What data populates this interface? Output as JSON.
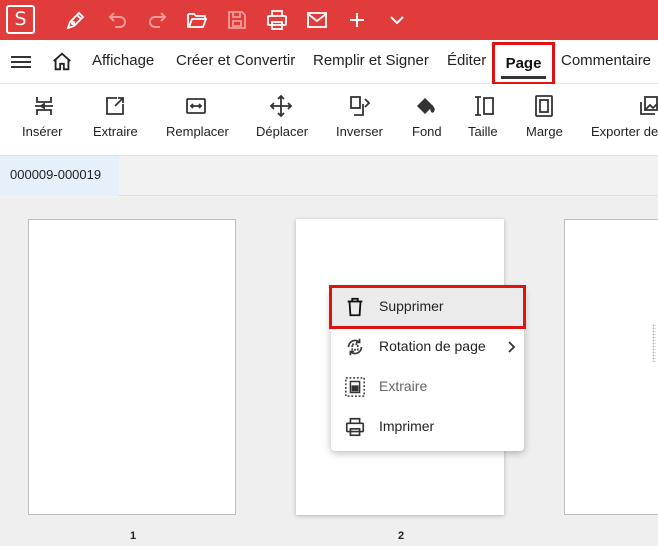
{
  "app": {
    "logo_letter": "S"
  },
  "menu": {
    "items": [
      {
        "label": "Affichage"
      },
      {
        "label": "Créer et Convertir"
      },
      {
        "label": "Remplir et Signer"
      },
      {
        "label": "Éditer"
      },
      {
        "label": "Page"
      },
      {
        "label": "Commentaire"
      }
    ],
    "active": "Page"
  },
  "toolbar": {
    "tools": [
      {
        "label": "Insérer",
        "icon": "insert-page-icon"
      },
      {
        "label": "Extraire",
        "icon": "extract-icon"
      },
      {
        "label": "Remplacer",
        "icon": "replace-icon"
      },
      {
        "label": "Déplacer",
        "icon": "move-icon"
      },
      {
        "label": "Inverser",
        "icon": "reverse-icon"
      },
      {
        "label": "Fond",
        "icon": "fill-bucket-icon"
      },
      {
        "label": "Taille",
        "icon": "size-icon"
      },
      {
        "label": "Marge",
        "icon": "margin-icon"
      },
      {
        "label": "Exporter de",
        "icon": "export-image-icon"
      }
    ]
  },
  "document_tab": {
    "label": "000009-000019"
  },
  "pages": [
    {
      "number": "1"
    },
    {
      "number": "2"
    }
  ],
  "context_menu": {
    "items": [
      {
        "label": "Supprimer",
        "icon": "trash-icon",
        "enabled": true,
        "highlighted": true
      },
      {
        "label": "Rotation de page",
        "icon": "rotate-icon",
        "enabled": true,
        "has_submenu": true
      },
      {
        "label": "Extraire",
        "icon": "extract-page-icon",
        "enabled": false
      },
      {
        "label": "Imprimer",
        "icon": "printer-icon",
        "enabled": true
      }
    ]
  },
  "colors": {
    "titlebar": "#e03c3c",
    "highlight_border": "#e01313",
    "tab_active": "#e6f0fb"
  }
}
